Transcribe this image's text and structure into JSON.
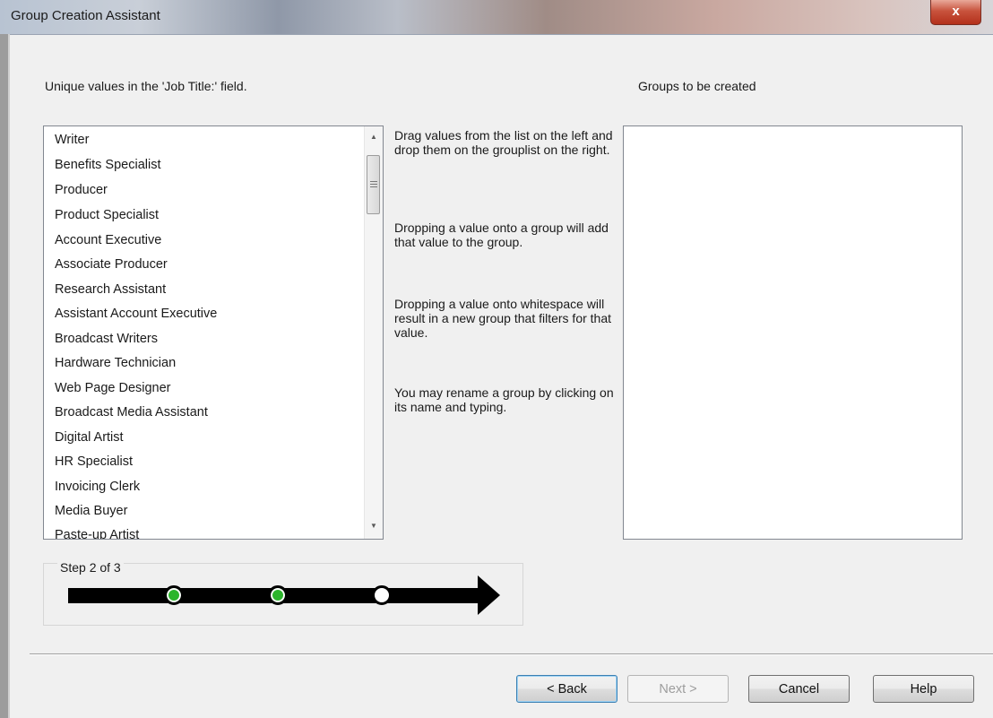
{
  "window": {
    "title": "Group Creation Assistant",
    "close_label": "x"
  },
  "values_label": "Unique values in the 'Job Title:' field.",
  "groups_label": "Groups to be created",
  "values_list": [
    "Writer",
    "Benefits Specialist",
    "Producer",
    "Product Specialist",
    "Account Executive",
    "Associate Producer",
    "Research Assistant",
    "Assistant Account Executive",
    "Broadcast Writers",
    "Hardware Technician",
    "Web Page Designer",
    "Broadcast Media Assistant",
    "Digital Artist",
    "HR Specialist",
    "Invoicing Clerk",
    "Media Buyer",
    "Paste-up Artist"
  ],
  "instructions": [
    "Drag values from the list on the left and drop them on the grouplist on the right.",
    "Dropping a value onto a group will add that value to the group.",
    "Dropping a value onto whitespace will result in a new group that filters for that value.",
    "You may rename a group by clicking on its name and typing."
  ],
  "groups_list": [],
  "progress": {
    "label": "Step 2 of 3",
    "current_step": 2,
    "total_steps": 3,
    "done_color": "#2bb52b"
  },
  "buttons": {
    "back": "< Back",
    "next": "Next >",
    "cancel": "Cancel",
    "help": "Help"
  }
}
